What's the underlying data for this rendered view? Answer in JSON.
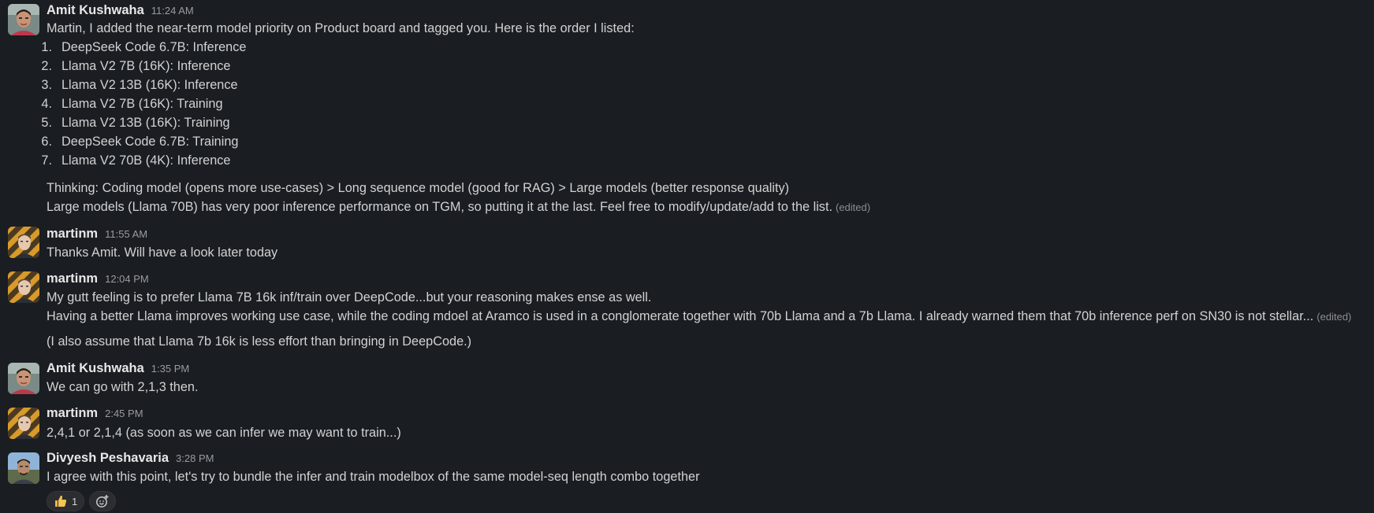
{
  "messages": [
    {
      "author": "Amit Kushwaha",
      "time": "11:24 AM",
      "avatar": "avatar-amit",
      "intro": "Martin, I added the near-term model priority on Product board and tagged you. Here is the order I listed:",
      "list": [
        {
          "n": "1.",
          "text": "DeepSeek Code 6.7B: Inference"
        },
        {
          "n": "2.",
          "text": "Llama V2 7B (16K): Inference"
        },
        {
          "n": "3.",
          "text": "Llama V2 13B (16K): Inference"
        },
        {
          "n": "4.",
          "text": "Llama V2 7B (16K): Training"
        },
        {
          "n": "5.",
          "text": "Llama V2 13B (16K): Training"
        },
        {
          "n": "6.",
          "text": "DeepSeek Code 6.7B: Training"
        },
        {
          "n": "7.",
          "text": "Llama V2 70B (4K): Inference"
        }
      ],
      "para1": "Thinking: Coding model (opens more use-cases) > Long sequence model (good for RAG) > Large models (better response quality)",
      "para2": "Large models (Llama 70B) has very poor inference performance on TGM, so putting it at the last. Feel free to modify/update/add to the list.",
      "edited": "(edited)"
    },
    {
      "author": "martinm",
      "time": "11:55 AM",
      "avatar": "avatar-martin",
      "text": "Thanks Amit. Will have a look later today"
    },
    {
      "author": "martinm",
      "time": "12:04 PM",
      "avatar": "avatar-martin",
      "line1": "My gutt feeling is to prefer Llama 7B 16k inf/train over DeepCode...but your reasoning makes ense as well.",
      "line2": "Having a better Llama improves working use case, while the coding mdoel at Aramco is used in a conglomerate together with 70b Llama and a 7b Llama. I already warned them that 70b inference perf on SN30 is not stellar...",
      "edited": "(edited)",
      "line3": "(I also assume that Llama 7b 16k is less effort than bringing in DeepCode.)"
    },
    {
      "author": "Amit Kushwaha",
      "time": "1:35 PM",
      "avatar": "avatar-amit",
      "text": "We can go with 2,1,3 then."
    },
    {
      "author": "martinm",
      "time": "2:45 PM",
      "avatar": "avatar-martin",
      "text": "2,4,1 or 2,1,4 (as soon as we can infer we may want to train...)"
    },
    {
      "author": "Divyesh Peshavaria",
      "time": "3:28 PM",
      "avatar": "avatar-divyesh",
      "text": "I agree with this point, let's try to bundle the infer and train modelbox of the same model-seq length combo together",
      "reaction": {
        "icon": "thumbs-up-icon",
        "count": "1"
      },
      "add_reaction_icon": "add-reaction-icon"
    }
  ],
  "colors": {
    "background": "#1a1d21",
    "text": "#d1d2d3",
    "name": "#e8e8e8",
    "timestamp": "#9a9b9d"
  }
}
